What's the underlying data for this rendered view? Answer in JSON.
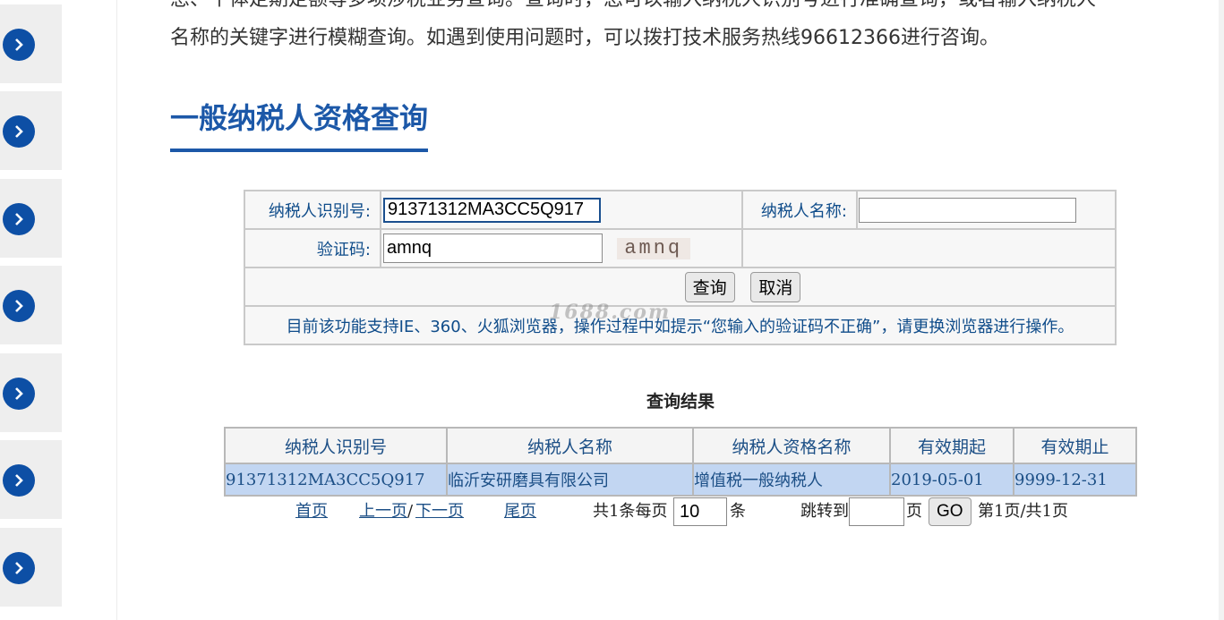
{
  "intro": {
    "line1": "息、个体定期定额等多项涉税业务查询。查询时，您可以输入纳税人识别号进行准确查询，或者输入纳税人",
    "line2": "名称的关键字进行模糊查询。如遇到使用问题时，可以拨打技术服务热线96612366进行咨询。"
  },
  "section_title": "一般纳税人资格查询",
  "form": {
    "taxpayer_id_label": "纳税人识别号:",
    "taxpayer_id_value": "91371312MA3CC5Q917",
    "taxpayer_name_label": "纳税人名称:",
    "taxpayer_name_value": "",
    "captcha_label": "验证码:",
    "captcha_value": "amnq",
    "captcha_image_text": "amnq",
    "query_button": "查询",
    "cancel_button": "取消",
    "notice": "目前该功能支持IE、360、火狐浏览器，操作过程中如提示“您输入的验证码不正确”，请更换浏览器进行操作。"
  },
  "watermark": "1688.com",
  "result": {
    "title": "查询结果",
    "columns": [
      "纳税人识别号",
      "纳税人名称",
      "纳税人资格名称",
      "有效期起",
      "有效期止"
    ],
    "rows": [
      [
        "91371312MA3CC5Q917",
        "临沂安研磨具有限公司",
        "增值税一般纳税人",
        "2019-05-01",
        "9999-12-31"
      ]
    ]
  },
  "pager": {
    "first": "首页",
    "prev": "上一页",
    "separator": "/",
    "next": "下一页",
    "last": "尾页",
    "total_per_page_prefix": "共1条每页",
    "page_size": "10",
    "unit": "条",
    "jump_to": "跳转到",
    "jump_value": "",
    "page_unit": "页",
    "go_button": "GO",
    "page_status": "第1页/共1页"
  },
  "sidebar": {
    "item_count": 7,
    "icon": "chevron-right-icon",
    "accent": "#0d4fa5"
  },
  "colors": {
    "title": "#1c58a8",
    "link": "#1c4f86",
    "row_highlight": "#c2d6f2"
  }
}
